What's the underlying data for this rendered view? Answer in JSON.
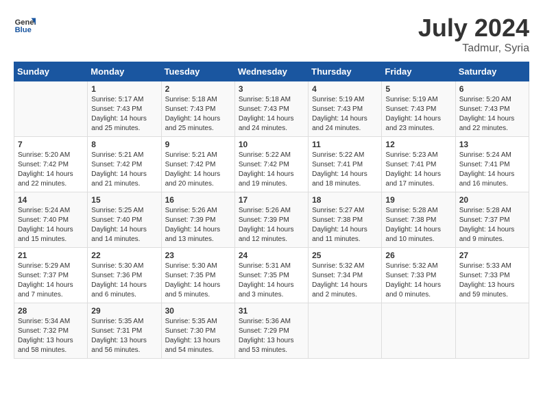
{
  "header": {
    "logo_line1": "General",
    "logo_line2": "Blue",
    "month": "July 2024",
    "location": "Tadmur, Syria"
  },
  "days_of_week": [
    "Sunday",
    "Monday",
    "Tuesday",
    "Wednesday",
    "Thursday",
    "Friday",
    "Saturday"
  ],
  "weeks": [
    [
      {
        "day": "",
        "info": ""
      },
      {
        "day": "1",
        "info": "Sunrise: 5:17 AM\nSunset: 7:43 PM\nDaylight: 14 hours\nand 25 minutes."
      },
      {
        "day": "2",
        "info": "Sunrise: 5:18 AM\nSunset: 7:43 PM\nDaylight: 14 hours\nand 25 minutes."
      },
      {
        "day": "3",
        "info": "Sunrise: 5:18 AM\nSunset: 7:43 PM\nDaylight: 14 hours\nand 24 minutes."
      },
      {
        "day": "4",
        "info": "Sunrise: 5:19 AM\nSunset: 7:43 PM\nDaylight: 14 hours\nand 24 minutes."
      },
      {
        "day": "5",
        "info": "Sunrise: 5:19 AM\nSunset: 7:43 PM\nDaylight: 14 hours\nand 23 minutes."
      },
      {
        "day": "6",
        "info": "Sunrise: 5:20 AM\nSunset: 7:43 PM\nDaylight: 14 hours\nand 22 minutes."
      }
    ],
    [
      {
        "day": "7",
        "info": "Sunrise: 5:20 AM\nSunset: 7:42 PM\nDaylight: 14 hours\nand 22 minutes."
      },
      {
        "day": "8",
        "info": "Sunrise: 5:21 AM\nSunset: 7:42 PM\nDaylight: 14 hours\nand 21 minutes."
      },
      {
        "day": "9",
        "info": "Sunrise: 5:21 AM\nSunset: 7:42 PM\nDaylight: 14 hours\nand 20 minutes."
      },
      {
        "day": "10",
        "info": "Sunrise: 5:22 AM\nSunset: 7:42 PM\nDaylight: 14 hours\nand 19 minutes."
      },
      {
        "day": "11",
        "info": "Sunrise: 5:22 AM\nSunset: 7:41 PM\nDaylight: 14 hours\nand 18 minutes."
      },
      {
        "day": "12",
        "info": "Sunrise: 5:23 AM\nSunset: 7:41 PM\nDaylight: 14 hours\nand 17 minutes."
      },
      {
        "day": "13",
        "info": "Sunrise: 5:24 AM\nSunset: 7:41 PM\nDaylight: 14 hours\nand 16 minutes."
      }
    ],
    [
      {
        "day": "14",
        "info": "Sunrise: 5:24 AM\nSunset: 7:40 PM\nDaylight: 14 hours\nand 15 minutes."
      },
      {
        "day": "15",
        "info": "Sunrise: 5:25 AM\nSunset: 7:40 PM\nDaylight: 14 hours\nand 14 minutes."
      },
      {
        "day": "16",
        "info": "Sunrise: 5:26 AM\nSunset: 7:39 PM\nDaylight: 14 hours\nand 13 minutes."
      },
      {
        "day": "17",
        "info": "Sunrise: 5:26 AM\nSunset: 7:39 PM\nDaylight: 14 hours\nand 12 minutes."
      },
      {
        "day": "18",
        "info": "Sunrise: 5:27 AM\nSunset: 7:38 PM\nDaylight: 14 hours\nand 11 minutes."
      },
      {
        "day": "19",
        "info": "Sunrise: 5:28 AM\nSunset: 7:38 PM\nDaylight: 14 hours\nand 10 minutes."
      },
      {
        "day": "20",
        "info": "Sunrise: 5:28 AM\nSunset: 7:37 PM\nDaylight: 14 hours\nand 9 minutes."
      }
    ],
    [
      {
        "day": "21",
        "info": "Sunrise: 5:29 AM\nSunset: 7:37 PM\nDaylight: 14 hours\nand 7 minutes."
      },
      {
        "day": "22",
        "info": "Sunrise: 5:30 AM\nSunset: 7:36 PM\nDaylight: 14 hours\nand 6 minutes."
      },
      {
        "day": "23",
        "info": "Sunrise: 5:30 AM\nSunset: 7:35 PM\nDaylight: 14 hours\nand 5 minutes."
      },
      {
        "day": "24",
        "info": "Sunrise: 5:31 AM\nSunset: 7:35 PM\nDaylight: 14 hours\nand 3 minutes."
      },
      {
        "day": "25",
        "info": "Sunrise: 5:32 AM\nSunset: 7:34 PM\nDaylight: 14 hours\nand 2 minutes."
      },
      {
        "day": "26",
        "info": "Sunrise: 5:32 AM\nSunset: 7:33 PM\nDaylight: 14 hours\nand 0 minutes."
      },
      {
        "day": "27",
        "info": "Sunrise: 5:33 AM\nSunset: 7:33 PM\nDaylight: 13 hours\nand 59 minutes."
      }
    ],
    [
      {
        "day": "28",
        "info": "Sunrise: 5:34 AM\nSunset: 7:32 PM\nDaylight: 13 hours\nand 58 minutes."
      },
      {
        "day": "29",
        "info": "Sunrise: 5:35 AM\nSunset: 7:31 PM\nDaylight: 13 hours\nand 56 minutes."
      },
      {
        "day": "30",
        "info": "Sunrise: 5:35 AM\nSunset: 7:30 PM\nDaylight: 13 hours\nand 54 minutes."
      },
      {
        "day": "31",
        "info": "Sunrise: 5:36 AM\nSunset: 7:29 PM\nDaylight: 13 hours\nand 53 minutes."
      },
      {
        "day": "",
        "info": ""
      },
      {
        "day": "",
        "info": ""
      },
      {
        "day": "",
        "info": ""
      }
    ]
  ]
}
